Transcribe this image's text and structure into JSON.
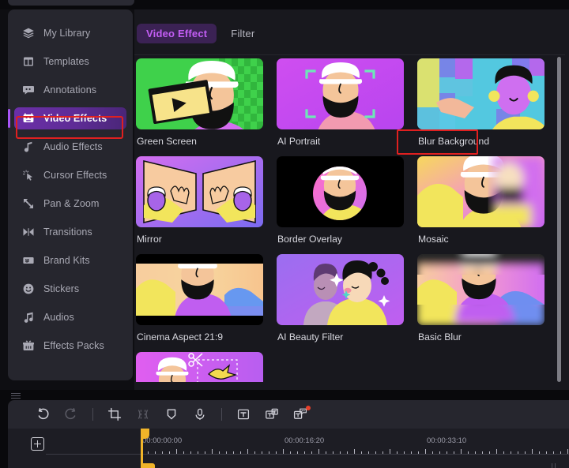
{
  "sidebar": {
    "items": [
      {
        "label": "My Library",
        "icon": "layers-icon",
        "active": false
      },
      {
        "label": "Templates",
        "icon": "templates-icon",
        "active": false
      },
      {
        "label": "Annotations",
        "icon": "annotations-icon",
        "active": false
      },
      {
        "label": "Video Effects",
        "icon": "video-effects-icon",
        "active": true
      },
      {
        "label": "Audio Effects",
        "icon": "audio-effects-icon",
        "active": false
      },
      {
        "label": "Cursor Effects",
        "icon": "cursor-effects-icon",
        "active": false
      },
      {
        "label": "Pan & Zoom",
        "icon": "pan-zoom-icon",
        "active": false
      },
      {
        "label": "Transitions",
        "icon": "transitions-icon",
        "active": false
      },
      {
        "label": "Brand Kits",
        "icon": "brand-kits-icon",
        "active": false
      },
      {
        "label": "Stickers",
        "icon": "stickers-icon",
        "active": false
      },
      {
        "label": "Audios",
        "icon": "audios-icon",
        "active": false
      },
      {
        "label": "Effects Packs",
        "icon": "effects-packs-icon",
        "active": false
      }
    ]
  },
  "effects_panel": {
    "tabs": [
      {
        "label": "Video Effect",
        "active": true
      },
      {
        "label": "Filter",
        "active": false
      }
    ],
    "items": [
      {
        "label": "Green Screen",
        "art": "green-screen"
      },
      {
        "label": "AI Portrait",
        "art": "ai-portrait",
        "highlighted": true
      },
      {
        "label": "Blur Background",
        "art": "blur-background"
      },
      {
        "label": "Mirror",
        "art": "mirror"
      },
      {
        "label": "Border Overlay",
        "art": "border-overlay"
      },
      {
        "label": "Mosaic",
        "art": "mosaic"
      },
      {
        "label": "Cinema Aspect 21:9",
        "art": "cinema-aspect"
      },
      {
        "label": "AI Beauty Filter",
        "art": "ai-beauty-filter"
      },
      {
        "label": "Basic Blur",
        "art": "basic-blur"
      },
      {
        "label": "",
        "art": "cutout-partial",
        "partial": true
      }
    ]
  },
  "toolbar": {
    "buttons": [
      {
        "name": "undo-icon",
        "label": "Undo",
        "disabled": false
      },
      {
        "name": "redo-icon",
        "label": "Redo",
        "disabled": true
      },
      {
        "name": "crop-icon",
        "label": "Crop"
      },
      {
        "name": "split-icon",
        "label": "Split",
        "disabled": true
      },
      {
        "name": "marker-icon",
        "label": "Marker"
      },
      {
        "name": "record-voiceover-icon",
        "label": "Record Voiceover"
      },
      {
        "name": "text-icon",
        "label": "Text"
      },
      {
        "name": "sticker-text-icon",
        "label": "Sticker Text"
      },
      {
        "name": "caption-icon",
        "label": "Caption",
        "badge": true
      }
    ]
  },
  "timeline": {
    "add_track_label": "+",
    "timecodes": [
      "00:00:00:00",
      "00:00:16:20",
      "00:00:33:10",
      "00"
    ],
    "playhead_position": "00:00:00:00"
  },
  "colors": {
    "accent_purple": "#a855f7",
    "tab_active_text": "#c35ef5",
    "tab_active_bg": "#3b2254",
    "highlight_red": "#e02020",
    "panel_bg": "#18181e",
    "sidebar_bg": "#26262e",
    "playhead": "#f0b429"
  }
}
